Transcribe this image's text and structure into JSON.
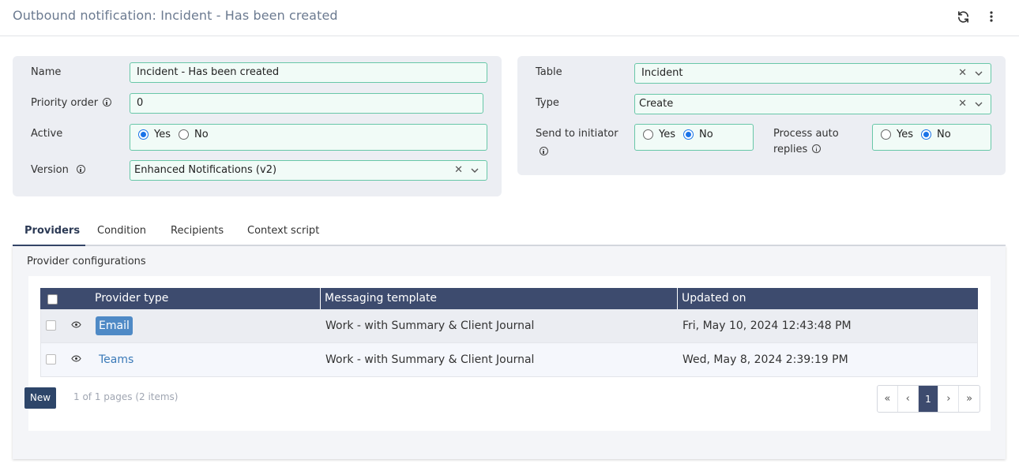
{
  "header": {
    "title": "Outbound notification: Incident - Has been created",
    "refresh_icon": "refresh-icon",
    "menu_icon": "more-vertical-icon"
  },
  "form_left": {
    "name_label": "Name",
    "name_value": "Incident - Has been created",
    "priority_label": "Priority order",
    "priority_value": "0",
    "active_label": "Active",
    "active_yes": "Yes",
    "active_no": "No",
    "active_selected": "Yes",
    "version_label": "Version",
    "version_value": "Enhanced Notifications (v2)"
  },
  "form_right": {
    "table_label": "Table",
    "table_value": "Incident",
    "type_label": "Type",
    "type_value": "Create",
    "send_label": "Send to initiator",
    "send_yes": "Yes",
    "send_no": "No",
    "send_selected": "No",
    "auto_label_1": "Process auto",
    "auto_label_2": "replies",
    "auto_yes": "Yes",
    "auto_no": "No",
    "auto_selected": "No"
  },
  "tabs": [
    {
      "label": "Providers",
      "active": true
    },
    {
      "label": "Condition",
      "active": false
    },
    {
      "label": "Recipients",
      "active": false
    },
    {
      "label": "Context script",
      "active": false
    }
  ],
  "providers": {
    "section_title": "Provider configurations",
    "columns": [
      "Provider type",
      "Messaging template",
      "Updated on"
    ],
    "rows": [
      {
        "provider": "Email",
        "template": "Work - with Summary & Client Journal",
        "updated": "Fri, May 10, 2024 12:43:48 PM"
      },
      {
        "provider": "Teams",
        "template": "Work - with Summary & Client Journal",
        "updated": "Wed, May 8, 2024 2:39:19 PM"
      }
    ],
    "new_label": "New",
    "page_info": "1 of 1 pages (2 items)",
    "pager": {
      "first": "«",
      "prev": "‹",
      "current": "1",
      "next": "›",
      "last": "»"
    }
  },
  "colors": {
    "accent": "#3d4b6e",
    "field_border": "#68c7a8",
    "radio_selected": "#1a73e8",
    "badge": "#4f8ac6"
  }
}
